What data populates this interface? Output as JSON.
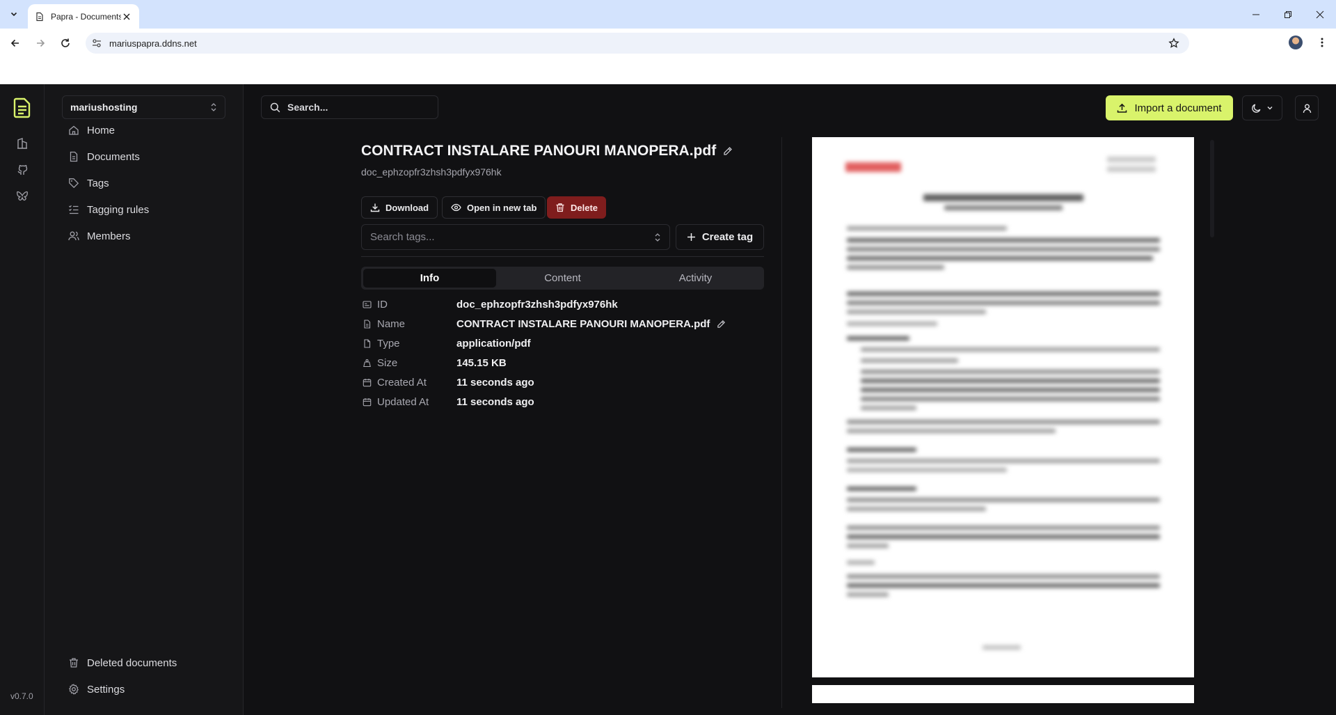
{
  "browser": {
    "tab_title": "Papra - Documents",
    "url": "mariuspapra.ddns.net"
  },
  "app": {
    "version": "v0.7.0",
    "organization": "mariushosting",
    "nav": [
      {
        "label": "Home"
      },
      {
        "label": "Documents"
      },
      {
        "label": "Tags"
      },
      {
        "label": "Tagging rules"
      },
      {
        "label": "Members"
      }
    ],
    "bottom_nav": [
      {
        "label": "Deleted documents"
      },
      {
        "label": "Settings"
      }
    ],
    "search_placeholder": "Search...",
    "import_label": "Import a document",
    "accent_color": "#d9f36b",
    "danger_color": "#7f1d1d"
  },
  "document": {
    "title": "CONTRACT INSTALARE PANOURI MANOPERA.pdf",
    "id": "doc_ephzopfr3zhsh3pdfyx976hk",
    "actions": {
      "download": "Download",
      "open_new_tab": "Open in new tab",
      "delete": "Delete"
    },
    "tags_placeholder": "Search tags...",
    "create_tag": "Create tag",
    "tabs": [
      "Info",
      "Content",
      "Activity"
    ],
    "active_tab": "Info",
    "info": [
      {
        "key": "ID",
        "value": "doc_ephzopfr3zhsh3pdfyx976hk",
        "icon": "id-card-icon"
      },
      {
        "key": "Name",
        "value": "CONTRACT INSTALARE PANOURI MANOPERA.pdf",
        "icon": "file-icon"
      },
      {
        "key": "Type",
        "value": "application/pdf",
        "icon": "file-type-icon"
      },
      {
        "key": "Size",
        "value": "145.15 KB",
        "icon": "weight-icon"
      },
      {
        "key": "Created At",
        "value": "11 seconds ago",
        "icon": "calendar-icon"
      },
      {
        "key": "Updated At",
        "value": "11 seconds ago",
        "icon": "calendar-icon"
      }
    ]
  }
}
